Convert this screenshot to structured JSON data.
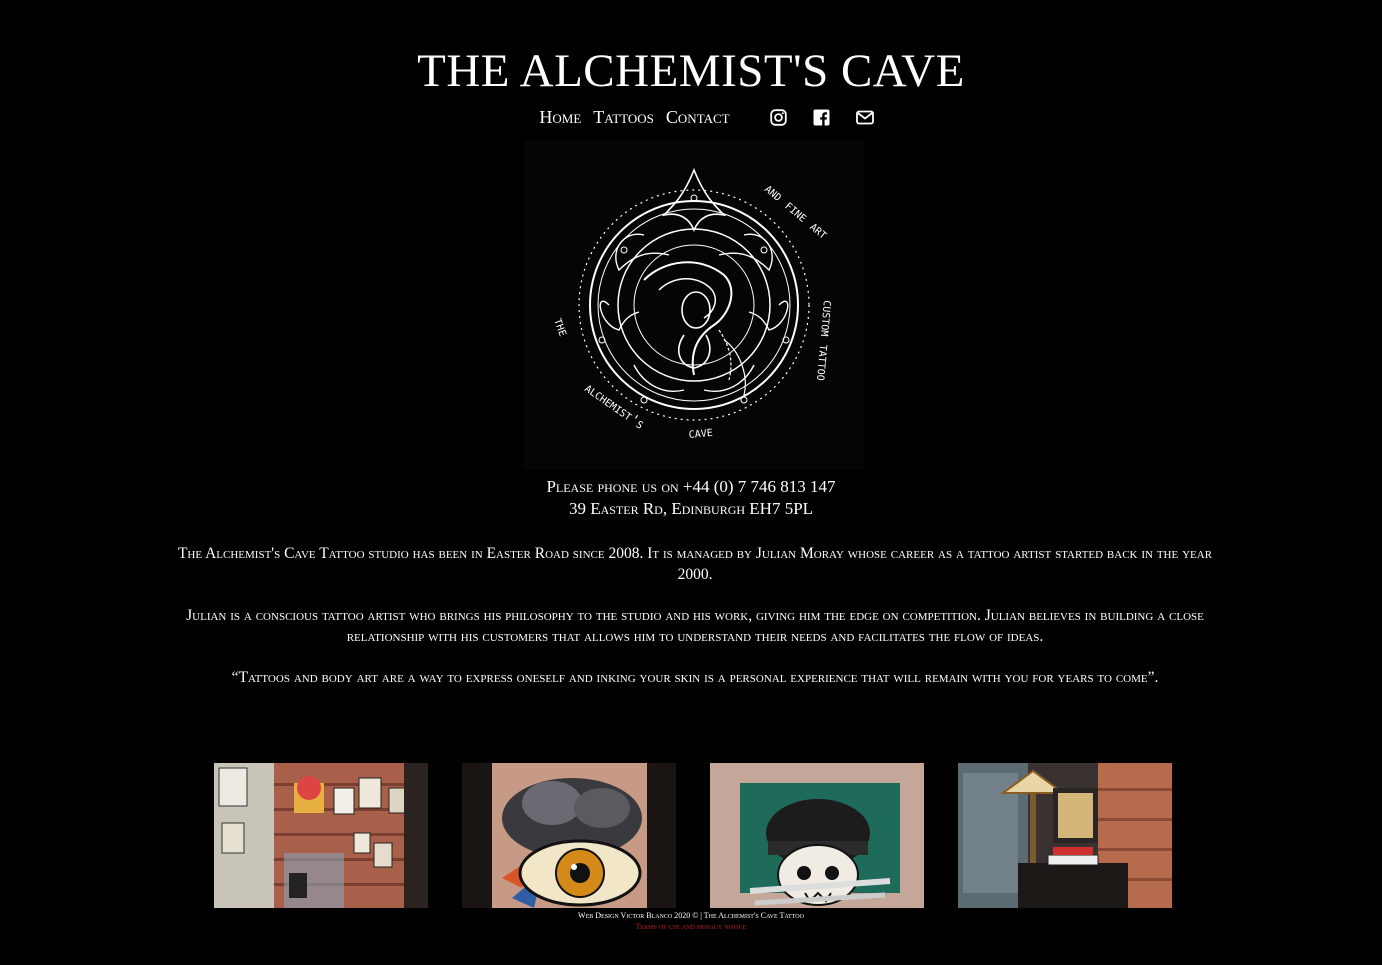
{
  "header": {
    "title": "THE ALCHEMIST'S CAVE"
  },
  "nav": {
    "items": [
      {
        "label": "Home"
      },
      {
        "label": "Tattoos"
      },
      {
        "label": "Contact"
      }
    ],
    "icons": [
      "instagram-icon",
      "facebook-icon",
      "envelope-icon"
    ]
  },
  "logo": {
    "outer_text_left": "the alchemist's cave",
    "outer_text_right": "custom tattoo and fine art"
  },
  "contact": {
    "phone_line": "Please phone us on +44 (0) 7 746 813 147",
    "address_line": "39 Easter Rd, Edinburgh EH7 5PL"
  },
  "about": {
    "para1": "The Alchemist's Cave Tattoo studio has been in Easter Road since 2008. It is managed by Julian Moray whose career as a tattoo artist started back in the year 2000.",
    "para2": "Julian is a conscious tattoo artist who brings his philosophy to the studio and his work, giving him the edge on competition. Julian believes in building a close relationship with his customers that allows him to understand their needs and facilitates the flow of ideas.",
    "quote": "“Tattoos and body art are a way to express oneself and inking your skin is a personal experience that will remain with you for years to come”."
  },
  "gallery": {
    "images": [
      "studio-interior",
      "eye-tattoo",
      "skull-tattoo",
      "studio-lamp"
    ]
  },
  "footer": {
    "credit": "Web Design Victor Blanco 2020 © | The Alchemist's Cave Tattoo",
    "terms_link": "Terms of use and privacy notice"
  },
  "colors": {
    "background": "#000000",
    "text": "#ffffff",
    "footer_link": "#c0201f"
  }
}
